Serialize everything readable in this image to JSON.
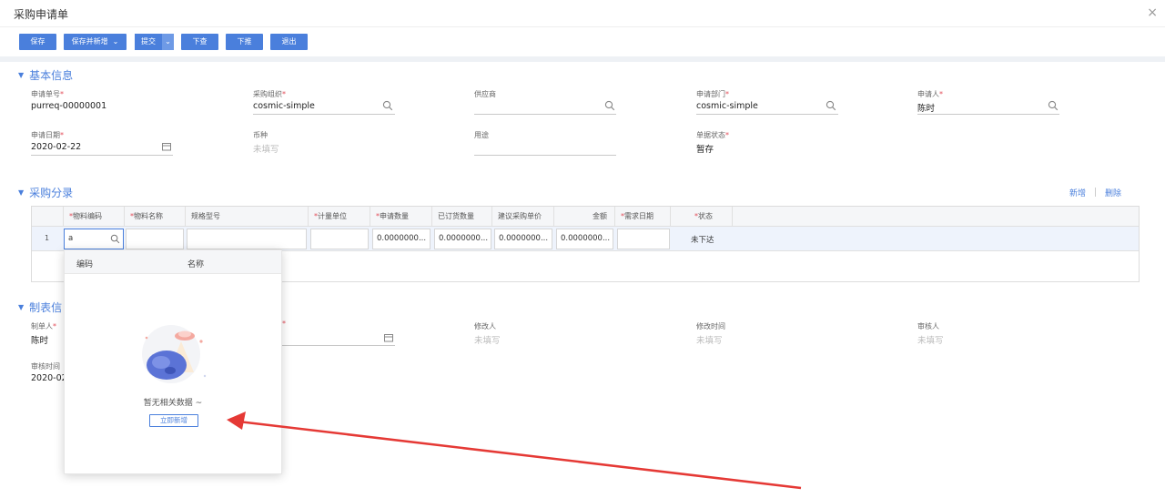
{
  "window": {
    "title": "采购申请单",
    "close_glyph": "×"
  },
  "toolbar": {
    "save": "保存",
    "save_and_new": "保存并新增",
    "submit": "提交",
    "push_down": "下查",
    "pull": "下推",
    "exit": "退出"
  },
  "basic_info": {
    "section_title": "基本信息",
    "req_no": {
      "label": "申请单号",
      "value": "purreq-00000001"
    },
    "purchase_org": {
      "label": "采购组织",
      "value": "cosmic-simple"
    },
    "supplier": {
      "label": "供应商",
      "value": ""
    },
    "apply_dept": {
      "label": "申请部门",
      "value": "cosmic-simple"
    },
    "applicant": {
      "label": "申请人",
      "value": "陈时"
    },
    "apply_date": {
      "label": "申请日期",
      "value": "2020-02-22"
    },
    "currency": {
      "label": "币种",
      "value": "未填写"
    },
    "usage": {
      "label": "用途",
      "value": ""
    },
    "bill_status": {
      "label": "单据状态",
      "value": "暂存"
    }
  },
  "purchase_entries": {
    "section_title": "采购分录",
    "add_label": "新增",
    "delete_label": "删除",
    "columns": [
      "物料编码",
      "物料名称",
      "规格型号",
      "计量单位",
      "申请数量",
      "已订货数量",
      "建议采购单价",
      "金额",
      "需求日期",
      "状态"
    ],
    "row": {
      "index": "1",
      "material_code": "a",
      "material_name": "",
      "spec": "",
      "unit": "",
      "apply_qty": "0.0000000...",
      "ordered_qty": "0.0000000...",
      "suggest_price": "0.0000000...",
      "amount": "0.0000000...",
      "demand_date": "",
      "status": "未下达"
    }
  },
  "lookup_popup": {
    "col_code": "编码",
    "col_name": "名称",
    "empty_text": "暂无相关数据 ~",
    "new_button": "立即新增"
  },
  "form_info": {
    "section_title": "制表信",
    "creator": {
      "label": "制单人",
      "value": "陈时"
    },
    "modifier": {
      "label": "修改人",
      "value": "未填写"
    },
    "modify_time": {
      "label": "修改时间",
      "value": "未填写"
    },
    "auditor": {
      "label": "审核人",
      "value": "未填写"
    },
    "audit_time": {
      "label": "审核时间",
      "value": "2020-02"
    }
  },
  "colors": {
    "accent": "#4a7fdc",
    "required": "#e34d59",
    "arrow": "#e53935"
  }
}
